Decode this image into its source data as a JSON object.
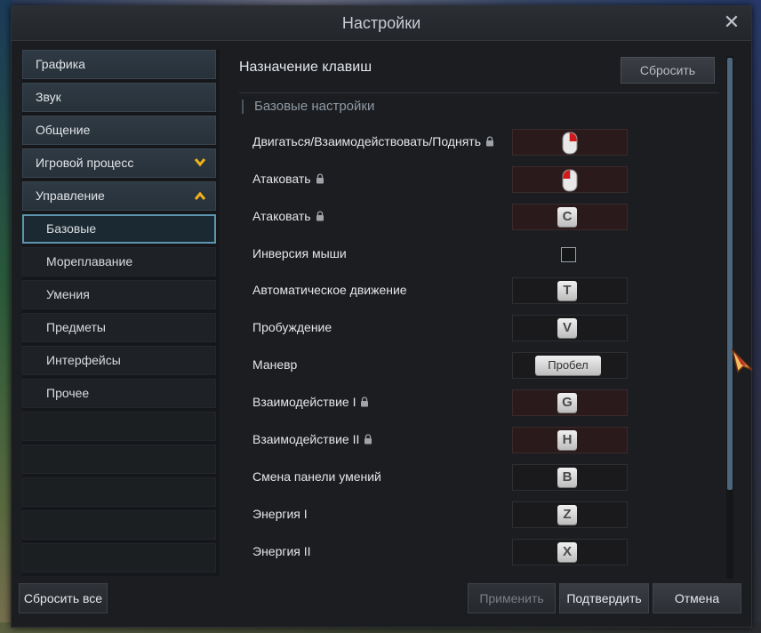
{
  "window": {
    "title": "Настройки"
  },
  "sidebar": {
    "items": [
      {
        "label": "Графика"
      },
      {
        "label": "Звук"
      },
      {
        "label": "Общение"
      },
      {
        "label": "Игровой процесс",
        "chevron": "chevron-down-icon"
      },
      {
        "label": "Управление",
        "chevron": "chevron-up-icon"
      }
    ],
    "subitems": [
      {
        "label": "Базовые",
        "active": true
      },
      {
        "label": "Мореплавание"
      },
      {
        "label": "Умения"
      },
      {
        "label": "Предметы"
      },
      {
        "label": "Интерфейсы"
      },
      {
        "label": "Прочее"
      }
    ]
  },
  "main": {
    "title": "Назначение клавиш",
    "reset_label": "Сбросить",
    "section": "Базовые настройки",
    "rows": [
      {
        "label": "Двигаться/Взаимодействовать/Поднять",
        "locked": true,
        "binding": "mouse-right-icon"
      },
      {
        "label": "Атаковать",
        "locked": true,
        "binding": "mouse-left-icon"
      },
      {
        "label": "Атаковать",
        "locked": true,
        "binding": "C"
      },
      {
        "label": "Инверсия мыши",
        "type": "checkbox",
        "checked": false
      },
      {
        "label": "Автоматическое движение",
        "binding": "T"
      },
      {
        "label": "Пробуждение",
        "binding": "V"
      },
      {
        "label": "Маневр",
        "binding": "Пробел"
      },
      {
        "label": "Взаимодействие I",
        "locked": true,
        "binding": "G"
      },
      {
        "label": "Взаимодействие II",
        "locked": true,
        "binding": "H"
      },
      {
        "label": "Смена панели умений",
        "binding": "B"
      },
      {
        "label": "Энергия I",
        "binding": "Z"
      },
      {
        "label": "Энергия II",
        "binding": "X"
      }
    ]
  },
  "footer": {
    "reset_all": "Сбросить все",
    "apply": "Применить",
    "confirm": "Подтвердить",
    "cancel": "Отмена"
  },
  "colors": {
    "accent": "#f0b21a",
    "active_border": "#5c95ad",
    "scrollbar": "#4d667c"
  }
}
